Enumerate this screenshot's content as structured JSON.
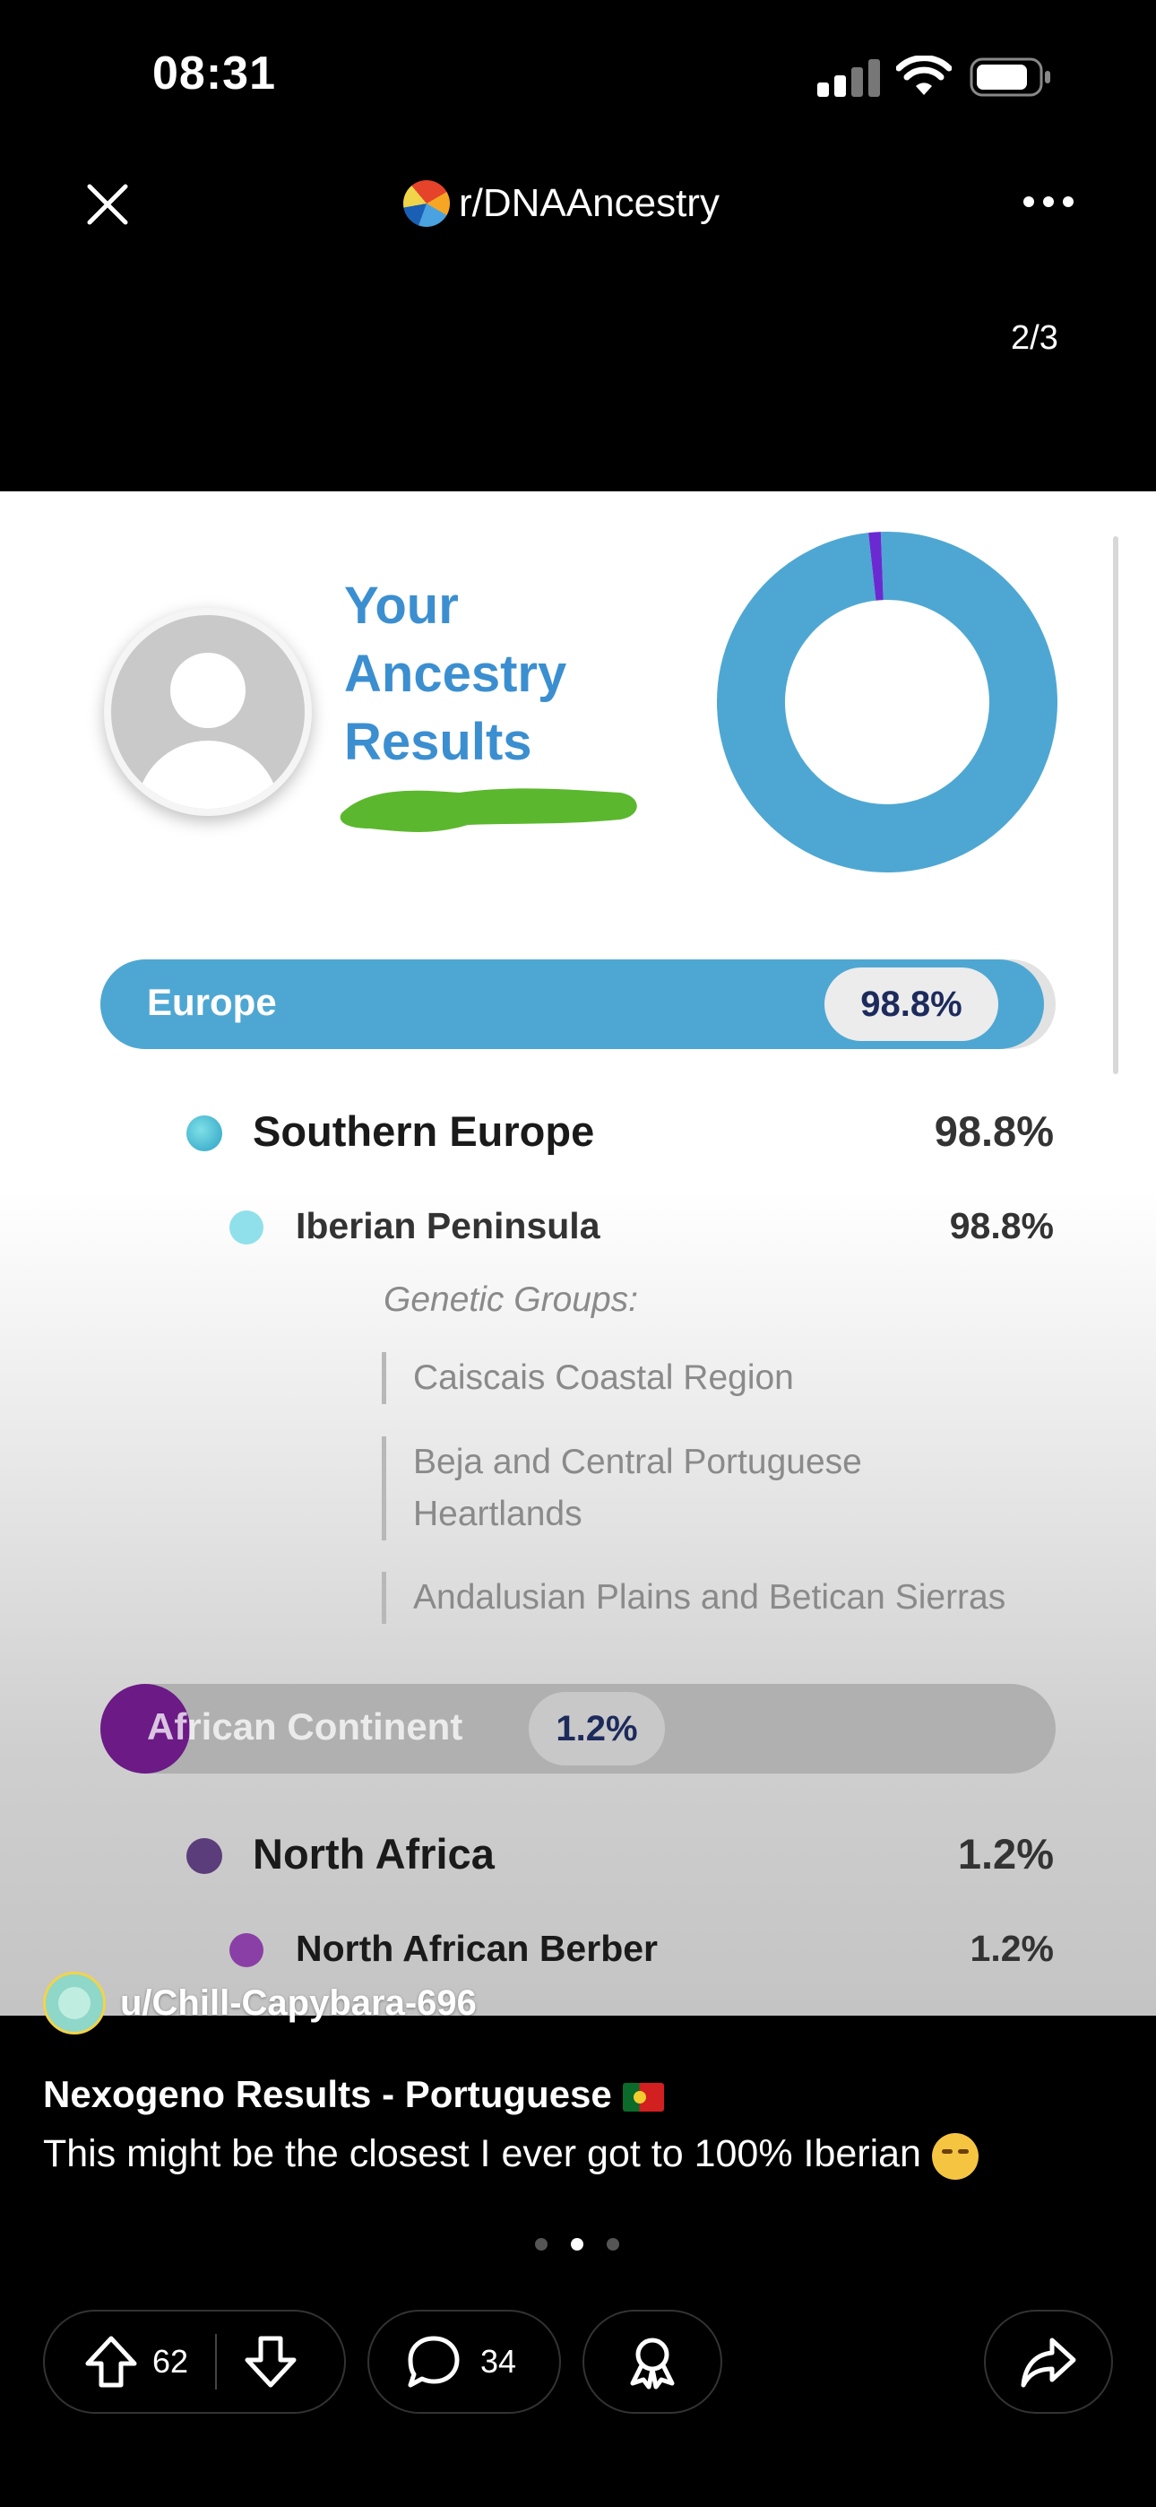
{
  "status_bar": {
    "time": "08:31"
  },
  "header": {
    "subreddit": "r/DNAAncestry",
    "counter": "2/3"
  },
  "image": {
    "title_lines": [
      "Your",
      "Ancestry",
      "Results"
    ],
    "donut": {
      "segments": [
        {
          "value": 98.8,
          "color": "#4ea7d2"
        },
        {
          "value": 1.2,
          "color": "#6b2ad1"
        }
      ]
    },
    "europe": {
      "label": "Europe",
      "percent": "98.8%",
      "fill": 0.988
    },
    "southern_europe": {
      "label": "Southern Europe",
      "percent": "98.8%"
    },
    "iberian": {
      "label": "Iberian Peninsula",
      "percent": "98.8%"
    },
    "genetic_groups_title": "Genetic Groups:",
    "genetic_groups": [
      "Caiscais Coastal Region",
      "Beja and Central Portuguese Heartlands",
      "Andalusian Plains and Betican Sierras"
    ],
    "africa": {
      "label": "African Continent",
      "percent": "1.2%",
      "fill": 0.012
    },
    "north_africa": {
      "label": "North Africa",
      "percent": "1.2%"
    },
    "berber": {
      "label": "North African Berber",
      "percent": "1.2%"
    }
  },
  "poster": {
    "username": "u/Chill-Capybara-696"
  },
  "post": {
    "title": "Nexogeno Results - Portuguese",
    "body": "This might be the closest I ever got to 100% Iberian"
  },
  "carousel": {
    "count": 3,
    "active": 2
  },
  "actions": {
    "upvotes": "62",
    "comments": "34"
  }
}
